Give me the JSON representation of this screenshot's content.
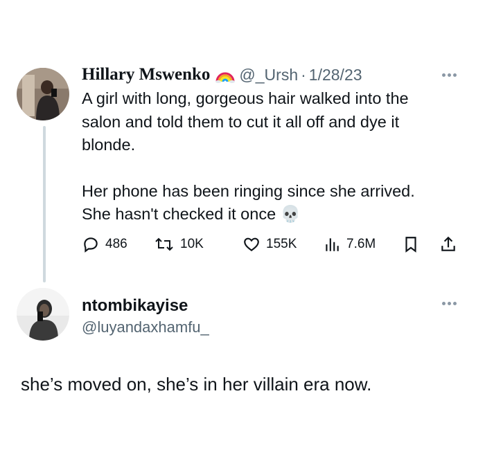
{
  "tweet": {
    "author_name": "Hillary Mswenko",
    "rainbow_icon": "rainbow-icon",
    "handle": "@_Ursh",
    "separator": "·",
    "date": "1/28/23",
    "body_lines": [
      "A girl with long, gorgeous hair walked into the",
      "salon and told them to cut it all off and dye it",
      "blonde.",
      "Her phone has been ringing since she arrived.",
      "She hasn't checked it once"
    ],
    "emoji": "💀",
    "actions": {
      "replies": "486",
      "retweets": "10K",
      "likes": "155K",
      "views": "7.6M"
    }
  },
  "reply": {
    "author_name": "ntombikayise",
    "handle": "@luyandaxhamfu_",
    "body": "she’s moved on, she’s in her villain era now."
  },
  "colors": {
    "text": "#0f1419",
    "secondary": "#536471",
    "thread_line": "#cfd9de"
  }
}
